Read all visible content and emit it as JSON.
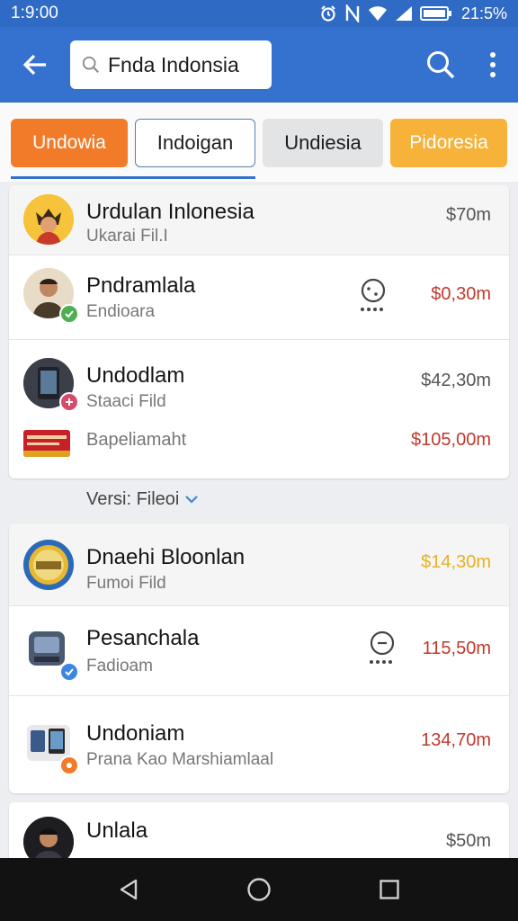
{
  "status_bar": {
    "time": "1:9:00",
    "battery": "21:5%"
  },
  "search": {
    "value": "Fnda Indonsia"
  },
  "filters": [
    {
      "label": "Undowia",
      "color": "#f27b2a"
    },
    {
      "label": "Indoigan",
      "color": "#ffffff"
    },
    {
      "label": "Undiesia",
      "color": "#e3e4e6"
    },
    {
      "label": "Pidoresia",
      "color": "#f7b23a"
    }
  ],
  "group1": [
    {
      "title": "Urdulan Inlonesia",
      "subtitle": "Ukarai Fil.I",
      "price": "$70m",
      "price_color": "#555555"
    },
    {
      "title": "Pndramlala",
      "subtitle": "Endioara",
      "price": "$0,30m",
      "price_color": "#c0392b"
    },
    {
      "title": "Undodlam",
      "subtitle": "Staaci Fild",
      "price": "$42,30m",
      "price_color": "#555555",
      "extra_subtitle": "Bapeliamaht",
      "extra_price": "$105,00m",
      "extra_price_color": "#c0392b"
    }
  ],
  "filter_link": {
    "label": "Versi: Fileoi"
  },
  "group2": [
    {
      "title": "Dnaehi Bloonlan",
      "subtitle": "Fumoi Fild",
      "price": "$14,30m",
      "price_color": "#e8b020"
    },
    {
      "title": "Pesanchala",
      "subtitle": "Fadioam",
      "price": "115,50m",
      "price_color": "#c0392b"
    },
    {
      "title": "Undoniam",
      "subtitle": "Prana Kao Marshiamlaal",
      "price": "134,70m",
      "price_color": "#c0392b"
    }
  ],
  "group3": [
    {
      "title": "Unlala",
      "price": "$50m",
      "price_color": "#555555"
    }
  ],
  "colors": {
    "app_bar": "#3572cf",
    "status_bar": "#2f6bc4",
    "verified": "#3b87e0",
    "badge_green": "#4caf50",
    "badge_orange": "#f27b2a",
    "badge_pink": "#d84a6a"
  }
}
